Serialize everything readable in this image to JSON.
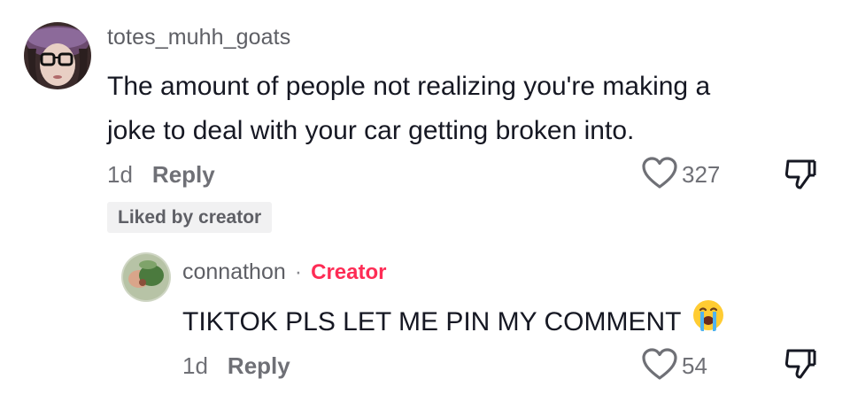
{
  "comment": {
    "username": "totes_muhh_goats",
    "text": "The amount of people not realizing you're making a",
    "text_line2": "joke to deal with your car getting broken into.",
    "time": "1d",
    "reply_label": "Reply",
    "likes": "327",
    "liked_by_creator": "Liked by creator",
    "avatar_icon": "user-avatar",
    "like_icon": "heart-outline-icon",
    "dislike_icon": "thumbs-down-outline-icon"
  },
  "reply": {
    "username": "connathon",
    "separator": "·",
    "creator_label": "Creator",
    "text": "TIKTOK PLS LET ME PIN MY COMMENT",
    "emoji_icon": "loudly-crying-face-emoji",
    "time": "1d",
    "reply_label": "Reply",
    "likes": "54",
    "avatar_icon": "user-avatar"
  },
  "colors": {
    "creator": "#fe2c55",
    "muted_text": "#6f7076",
    "primary_text": "#161823",
    "badge_bg": "#f1f1f2"
  }
}
